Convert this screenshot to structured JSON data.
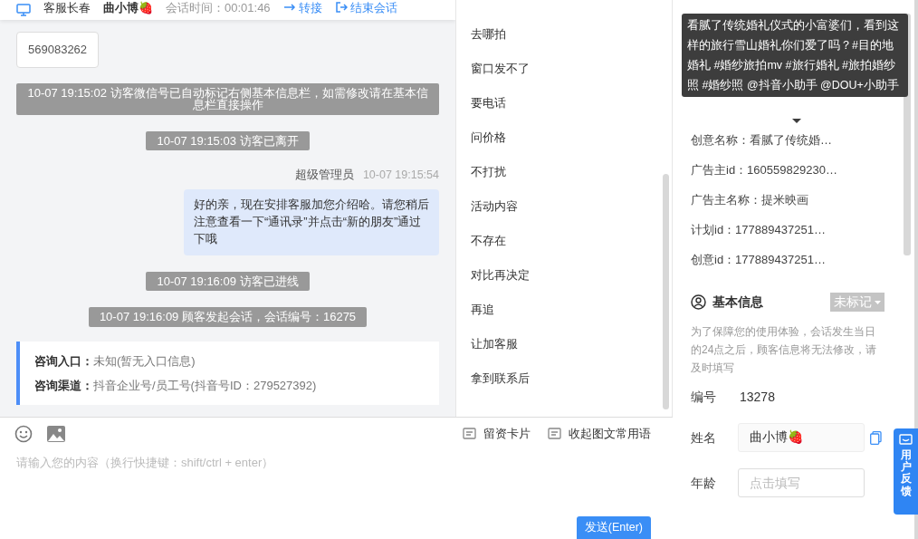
{
  "header": {
    "agent": "客服长春",
    "customer": "曲小博🍓",
    "duration": "会话时间：00:01:46",
    "buttons": [
      {
        "kind": "transfer",
        "label": "转接"
      },
      {
        "kind": "end",
        "label": "结束会话"
      }
    ]
  },
  "messages": [
    {
      "kind": "customer",
      "text": "569083262"
    },
    {
      "kind": "notice",
      "text": "10-07 19:15:02 访客微信号已自动标记右侧基本信息栏，如需修改请在基本信息栏直接操作"
    },
    {
      "kind": "system",
      "text": "10-07 19:15:03 访客已离开"
    },
    {
      "kind": "agent",
      "sender": "超级管理员",
      "time": "10-07 19:15:54",
      "text": "好的亲，现在安排客服加您介绍哈。请您稍后注意查看一下“通讯录”并点击“新的朋友”通过下哦"
    },
    {
      "kind": "system",
      "text": "10-07 19:16:09 访客已进线"
    },
    {
      "kind": "system",
      "text": "10-07 19:16:09 顾客发起会话，会话编号：16275"
    },
    {
      "kind": "info",
      "rows": [
        {
          "label": "咨询入口：",
          "value": "未知(暂无入口信息)"
        },
        {
          "label": "咨询渠道：",
          "value": "抖音企业号/员工号(抖音号ID：279527392)"
        }
      ]
    }
  ],
  "composer": {
    "actions": [
      "留资卡片",
      "收起图文常用语"
    ],
    "placeholder": "请输入您的内容（换行快捷键：shift/ctrl + enter）",
    "send": "发送(Enter)"
  },
  "quick_replies": [
    "去哪拍",
    "窗口发不了",
    "要电话",
    "问价格",
    "不打扰",
    "活动内容",
    "不存在",
    "对比再决定",
    "再追",
    "让加客服",
    "拿到联系后"
  ],
  "source_items": [
    "创意名称：看腻了传统婚…",
    "广告主id：160559829230…",
    "广告主名称：提米映画",
    "计划id：177889437251…",
    "创意id：177889437251…"
  ],
  "tooltip": "看腻了传统婚礼仪式的小富婆们，看到这样的旅行雪山婚礼你们爱了吗？#目的地婚礼 #婚纱旅拍mv #旅行婚礼 #旅拍婚纱照 #婚纱照 @抖音小助手 @DOU+小助手",
  "basic_info": {
    "title": "基本信息",
    "tag": "未标记",
    "note": "为了保障您的使用体验，会话发生当日的24点之后，顾客信息将无法修改，请及时填写",
    "fields": [
      {
        "kind": "text",
        "label": "编号",
        "value": "13278"
      },
      {
        "kind": "input",
        "label": "姓名",
        "value": "曲小博🍓"
      },
      {
        "kind": "input",
        "label": "年龄",
        "placeholder": "点击填写"
      }
    ]
  },
  "feedback": "用户反馈"
}
